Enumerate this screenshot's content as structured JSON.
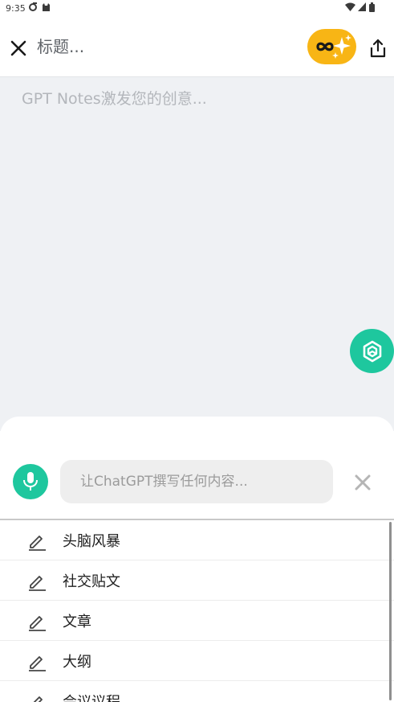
{
  "status_bar": {
    "time": "9:35"
  },
  "header": {
    "title_placeholder": "标题..."
  },
  "editor": {
    "placeholder": "GPT Notes激发您的创意..."
  },
  "assistant": {
    "prompt_placeholder": "让ChatGPT撰写任何内容...",
    "suggestions": [
      {
        "label": "头脑风暴"
      },
      {
        "label": "社交贴文"
      },
      {
        "label": "文章"
      },
      {
        "label": "大纲"
      },
      {
        "label": "会议议程"
      }
    ]
  },
  "colors": {
    "accent_green": "#1ec79e",
    "pro_badge_yellow": "#f8b515",
    "note_background": "#eff1f4"
  }
}
